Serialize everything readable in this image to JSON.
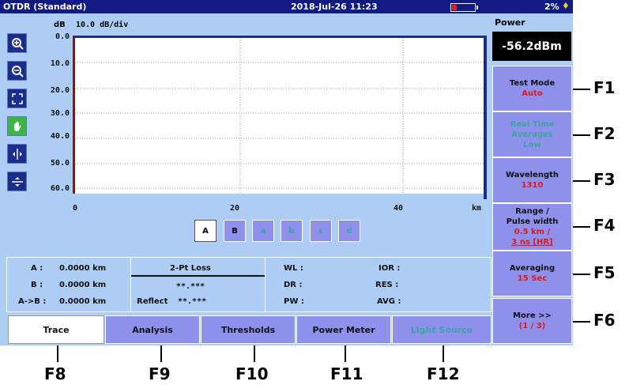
{
  "title": "OTDR (Standard)",
  "datetime": "2018-Jul-26 11:23",
  "battery_percent": "2%",
  "axis": {
    "y_unit": "dB",
    "scale": "10.0 dB/div",
    "y_ticks": [
      "0.0",
      "10.0",
      "20.0",
      "30.0",
      "40.0",
      "50.0",
      "60.0"
    ],
    "x_ticks": [
      "0",
      "20",
      "40"
    ],
    "x_unit": "km"
  },
  "trace_buttons": [
    "A",
    "B",
    "a",
    "b",
    "c",
    "d"
  ],
  "info": {
    "a_label": "A :",
    "a_val": "0.0000 km",
    "b_label": "B :",
    "b_val": "0.0000 km",
    "ab_label": "A->B :",
    "ab_val": "0.0000 km",
    "loss_title": "2-Pt Loss",
    "loss_val": "**.***",
    "reflect_label": "Reflect",
    "reflect_val": "**.***",
    "wl": "WL :",
    "dr": "DR :",
    "pw": "PW :",
    "ior": "IOR :",
    "res": "RES :",
    "avg": "AVG :"
  },
  "tabs": [
    "Trace",
    "Analysis",
    "Thresholds",
    "Power Meter",
    "Light Source"
  ],
  "power": {
    "label": "Power",
    "value": "-56.2dBm"
  },
  "fkeys": [
    {
      "l1": "Test Mode",
      "l2": "Auto"
    },
    {
      "l1": "Real Time",
      "l2": "Averages",
      "l3": "Low"
    },
    {
      "l1": "Wavelength",
      "l2": "1310"
    },
    {
      "l1": "Range /",
      "l2": "Pulse width",
      "l3": "0.5 km /",
      "l4": "3 ns [HR]"
    },
    {
      "l1": "Averaging",
      "l2": "15 Sec"
    },
    {
      "l1": "More >>",
      "l2": "(1 / 3)"
    }
  ],
  "fkey_labels": [
    "F1",
    "F2",
    "F3",
    "F4",
    "F5",
    "F6"
  ],
  "bottom_labels": [
    "F8",
    "F9",
    "F10",
    "F11",
    "F12"
  ],
  "colors": {
    "titlebar": "#101a80",
    "screen_bg": "#aecdf5",
    "softkey": "#8e90ec",
    "value_red": "#e01818"
  }
}
